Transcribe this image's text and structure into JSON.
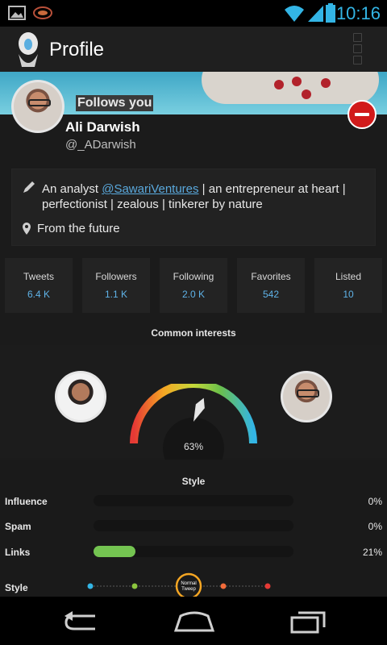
{
  "status_bar": {
    "time": "10:16"
  },
  "action_bar": {
    "title": "Profile"
  },
  "profile": {
    "follows_label": "Follows you",
    "name": "Ali Darwish",
    "handle": "@_ADarwish",
    "bio_pre": "An analyst ",
    "bio_link": "@SawariVentures",
    "bio_post": " | an entrepreneur at heart | perfectionist | zealous | tinkerer by nature",
    "location": "From the future"
  },
  "stats": [
    {
      "label": "Tweets",
      "value": "6.4 K"
    },
    {
      "label": "Followers",
      "value": "1.1 K"
    },
    {
      "label": "Following",
      "value": "2.0 K"
    },
    {
      "label": "Favorites",
      "value": "542"
    },
    {
      "label": "Listed",
      "value": "10"
    }
  ],
  "common_interests": {
    "title": "Common interests",
    "percent": "63%",
    "value": 0.63
  },
  "style": {
    "title": "Style",
    "bars": [
      {
        "label": "Influence",
        "pct": "0%",
        "value": 0
      },
      {
        "label": "Spam",
        "pct": "0%",
        "value": 0
      },
      {
        "label": "Links",
        "pct": "21%",
        "value": 0.21
      }
    ],
    "slider_label": "Style",
    "slider_value_l1": "Normal",
    "slider_value_l2": "Tweep",
    "slider_colors": [
      "#33b5e5",
      "#8cc63e",
      "#f5a623",
      "#f26b3a",
      "#e53935"
    ]
  }
}
